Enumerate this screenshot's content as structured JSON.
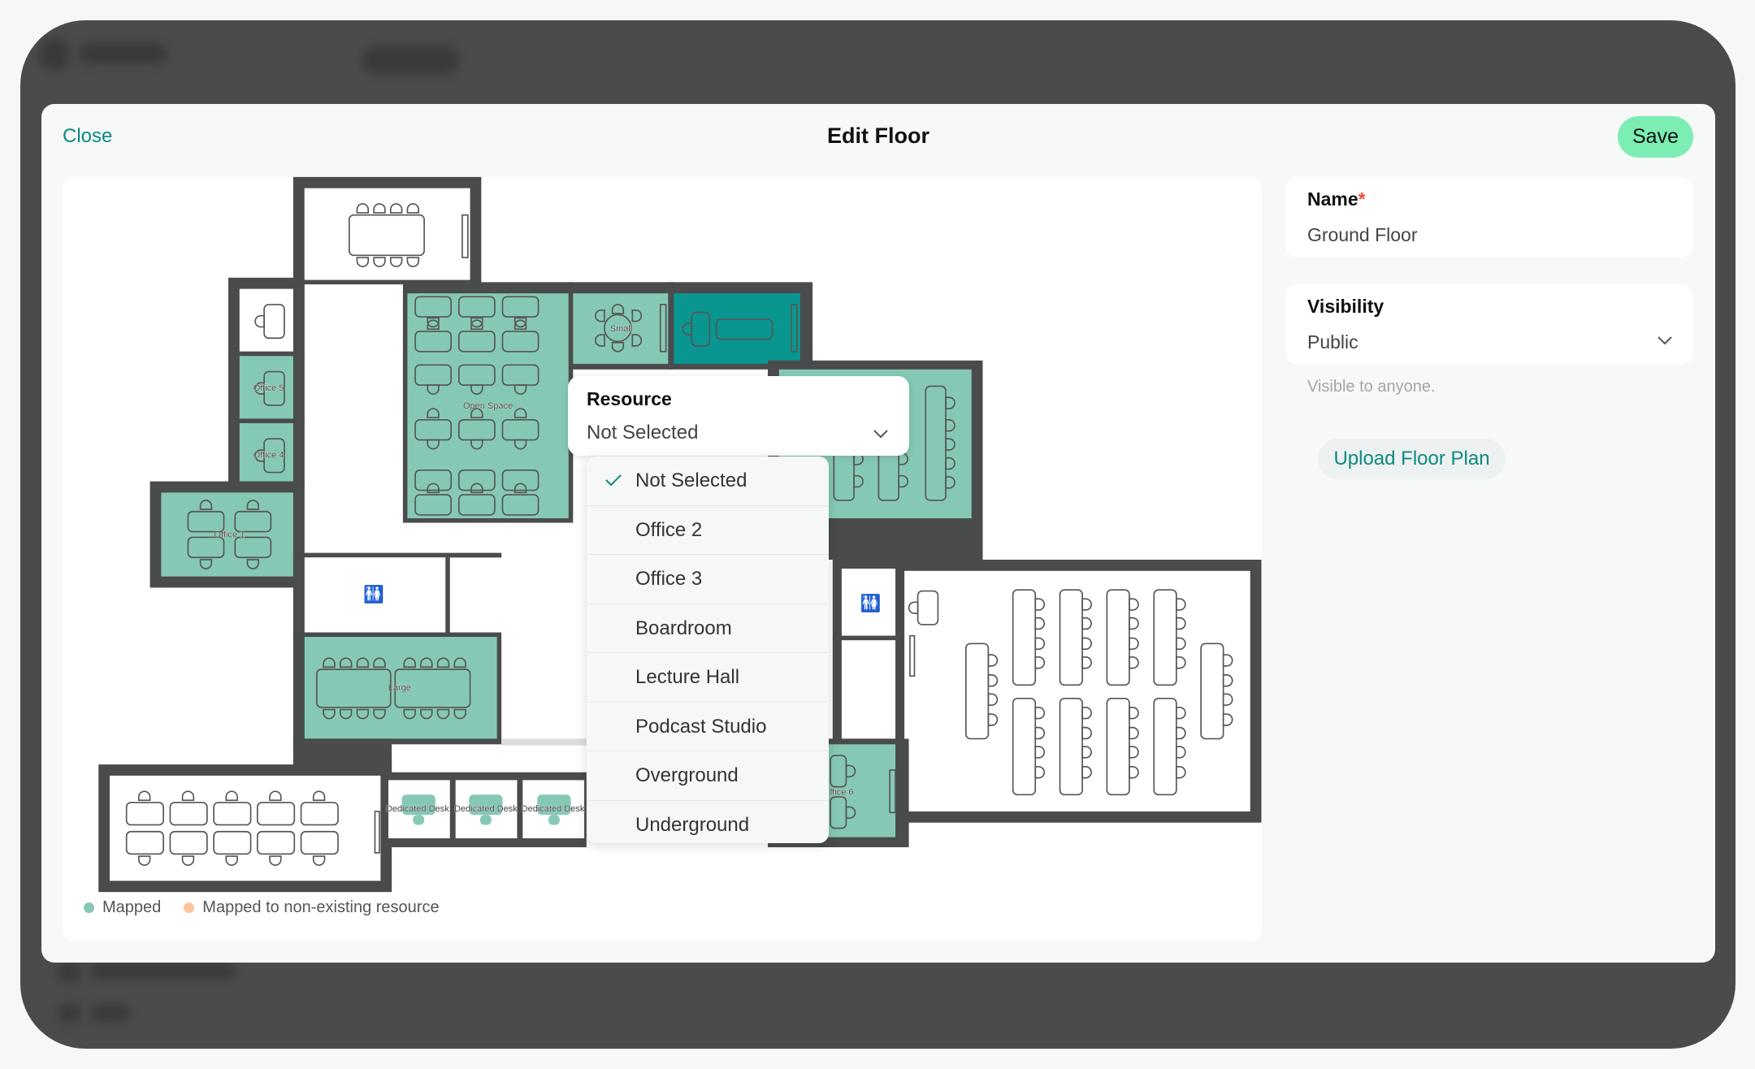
{
  "modal": {
    "close_label": "Close",
    "title": "Edit Floor",
    "save_label": "Save"
  },
  "form": {
    "name_label": "Name",
    "name_required": "*",
    "name_value": "Ground Floor",
    "visibility_label": "Visibility",
    "visibility_value": "Public",
    "visibility_hint": "Visible to anyone.",
    "upload_label": "Upload Floor Plan"
  },
  "resource": {
    "label": "Resource",
    "value": "Not Selected",
    "options": [
      {
        "label": "Not Selected",
        "selected": true
      },
      {
        "label": "Office 2",
        "selected": false
      },
      {
        "label": "Office 3",
        "selected": false
      },
      {
        "label": "Boardroom",
        "selected": false
      },
      {
        "label": "Lecture Hall",
        "selected": false
      },
      {
        "label": "Podcast Studio",
        "selected": false
      },
      {
        "label": "Overground",
        "selected": false
      },
      {
        "label": "Underground",
        "selected": false
      }
    ]
  },
  "floorplan": {
    "rooms": {
      "office5": "Office 5",
      "office4": "Office 4",
      "office1": "Office 1",
      "open_space": "Open Space",
      "small": "Small",
      "large": "Large",
      "desk1": "Dedicated Desk",
      "desk2": "Dedicated Desk",
      "desk3": "Dedicated Desk",
      "office6": "ffice 6"
    }
  },
  "legend": {
    "mapped": "Mapped",
    "mapped_nonexisting": "Mapped to non-existing resource"
  },
  "colors": {
    "accent": "#0a8a80",
    "save": "#7ceeb3",
    "mapped": "#86c8b6",
    "selected_room": "#0a9690",
    "non_existing": "#fdc49a",
    "wall": "#4a4b4d",
    "required": "#f04a3a"
  }
}
